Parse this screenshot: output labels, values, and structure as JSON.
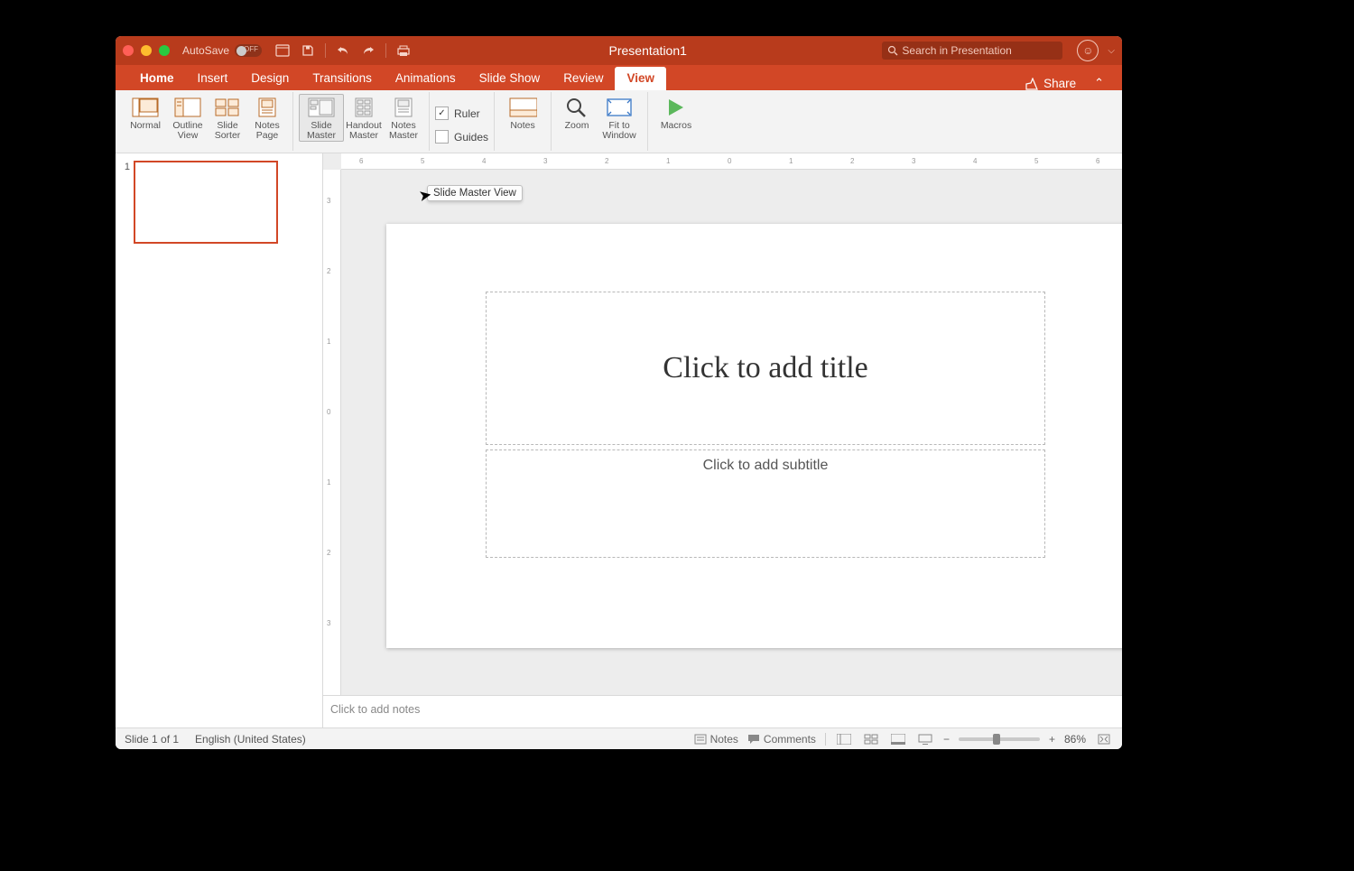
{
  "titlebar": {
    "autosave_label": "AutoSave",
    "autosave_state": "OFF",
    "document_title": "Presentation1",
    "search_placeholder": "Search in Presentation"
  },
  "tabs": {
    "items": [
      "Home",
      "Insert",
      "Design",
      "Transitions",
      "Animations",
      "Slide Show",
      "Review",
      "View"
    ],
    "active": "View",
    "share": "Share"
  },
  "ribbon": {
    "views": [
      "Normal",
      "Outline View",
      "Slide Sorter",
      "Notes Page"
    ],
    "masters": [
      "Slide Master",
      "Handout Master",
      "Notes Master"
    ],
    "show": {
      "ruler": "Ruler",
      "ruler_checked": true,
      "guides": "Guides",
      "guides_checked": false
    },
    "notes": "Notes",
    "zoom": "Zoom",
    "fit": "Fit to Window",
    "macros": "Macros",
    "tooltip": "Slide Master View"
  },
  "thumbs": {
    "items": [
      {
        "num": "1"
      }
    ]
  },
  "slide": {
    "title_placeholder": "Click to add title",
    "subtitle_placeholder": "Click to add subtitle"
  },
  "notes": {
    "placeholder": "Click to add notes"
  },
  "status": {
    "slide": "Slide 1 of 1",
    "lang": "English (United States)",
    "notes": "Notes",
    "comments": "Comments",
    "zoom": "86%"
  },
  "ruler": {
    "h": [
      "6",
      "5",
      "4",
      "3",
      "2",
      "1",
      "0",
      "1",
      "2",
      "3",
      "4",
      "5",
      "6"
    ],
    "v": [
      "3",
      "2",
      "1",
      "0",
      "1",
      "2",
      "3"
    ]
  }
}
